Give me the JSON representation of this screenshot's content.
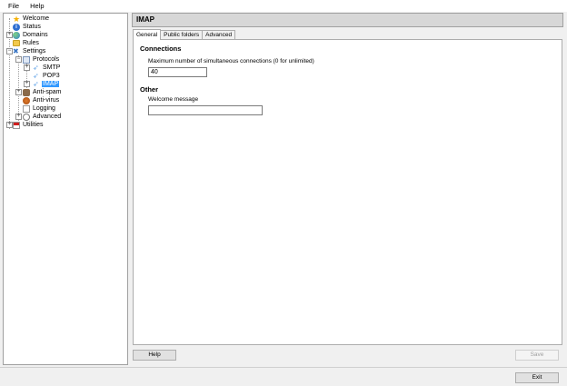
{
  "menu": {
    "file": "File",
    "help": "Help"
  },
  "tree": {
    "welcome": "Welcome",
    "status": "Status",
    "domains": "Domains",
    "rules": "Rules",
    "settings": "Settings",
    "protocols": "Protocols",
    "smtp": "SMTP",
    "pop3": "POP3",
    "imap": "IMAP",
    "antispam": "Anti-spam",
    "antivirus": "Anti-virus",
    "logging": "Logging",
    "advanced": "Advanced",
    "utilities": "Utilities"
  },
  "panel": {
    "title": "IMAP",
    "tabs": [
      "General",
      "Public folders",
      "Advanced"
    ],
    "active_tab": "General",
    "connections": {
      "heading": "Connections",
      "max_label": "Maximum number of simultaneous connections (0 for unlimited)",
      "max_value": "40"
    },
    "other": {
      "heading": "Other",
      "welcome_label": "Welcome message",
      "welcome_value": ""
    }
  },
  "buttons": {
    "help": "Help",
    "save": "Save",
    "exit": "Exit"
  }
}
